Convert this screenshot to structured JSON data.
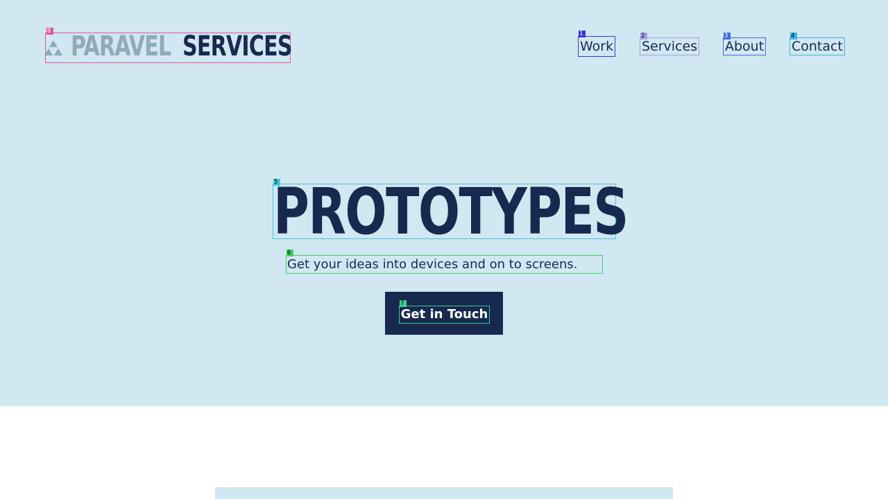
{
  "header": {
    "logo": {
      "word1": "PARAVEL",
      "word2": "SERVICES",
      "icon": "triangles-icon"
    },
    "nav": [
      {
        "label": "Work"
      },
      {
        "label": "Services"
      },
      {
        "label": "About"
      },
      {
        "label": "Contact"
      }
    ]
  },
  "hero": {
    "headline": "PROTOTYPES",
    "subheadline": "Get your ideas into devices and on to screens.",
    "cta_label": "Get in Touch"
  },
  "markers": [
    "0",
    "1",
    "2",
    "3",
    "4",
    "5",
    "6",
    "7"
  ],
  "colors": {
    "hero_bg": "#d1e7f1",
    "navy": "#17294f",
    "logo_grey": "#90aab9",
    "white": "#ffffff"
  }
}
